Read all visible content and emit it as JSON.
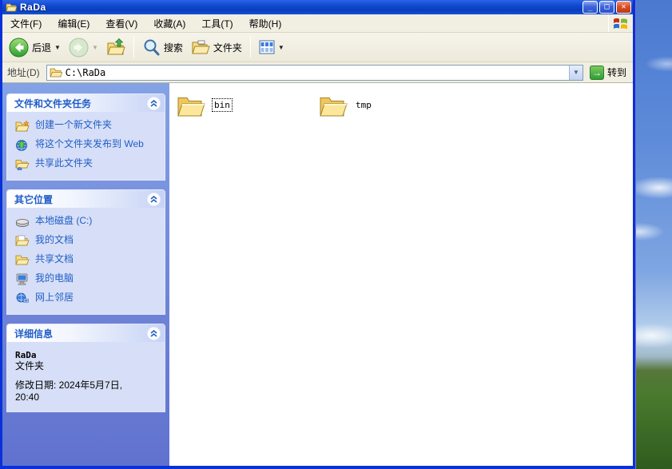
{
  "window": {
    "title": "RaDa"
  },
  "title_bar": {
    "minimize_glyph": "_",
    "maximize_glyph": "□",
    "close_glyph": "✕"
  },
  "menu_bar": {
    "items": [
      "文件(F)",
      "编辑(E)",
      "查看(V)",
      "收藏(A)",
      "工具(T)",
      "帮助(H)"
    ]
  },
  "toolbar": {
    "back_label": "后退",
    "search_label": "搜索",
    "folders_label": "文件夹"
  },
  "address_bar": {
    "label": "地址(D)",
    "value": "C:\\RaDa",
    "go_label": "转到"
  },
  "sidebar": {
    "panels": [
      {
        "title": "文件和文件夹任务",
        "items": [
          {
            "label": "创建一个新文件夹",
            "icon": "new-folder-icon"
          },
          {
            "label": "将这个文件夹发布到 Web",
            "icon": "publish-web-icon"
          },
          {
            "label": "共享此文件夹",
            "icon": "share-folder-icon"
          }
        ]
      },
      {
        "title": "其它位置",
        "items": [
          {
            "label": "本地磁盘 (C:)",
            "icon": "local-disk-icon"
          },
          {
            "label": "我的文档",
            "icon": "my-documents-icon"
          },
          {
            "label": "共享文档",
            "icon": "shared-documents-icon"
          },
          {
            "label": "我的电脑",
            "icon": "my-computer-icon"
          },
          {
            "label": "网上邻居",
            "icon": "network-places-icon"
          }
        ]
      },
      {
        "title": "详细信息",
        "details": {
          "name": "RaDa",
          "type": "文件夹",
          "modified_line1": "修改日期: 2024年5月7日,",
          "modified_line2": "20:40"
        }
      }
    ]
  },
  "content": {
    "folders": [
      {
        "name": "bin",
        "selected": true
      },
      {
        "name": "tmp",
        "selected": false
      }
    ]
  },
  "colors": {
    "titlebar_blue": "#1149CE",
    "window_border": "#0831D9",
    "sidebar_top": "#84A2E6",
    "sidebar_bottom": "#6072CE",
    "panel_body": "#D6DFF7",
    "link_blue": "#215DC6",
    "chrome_tan": "#F1EFE2",
    "close_red": "#DA4F26",
    "go_green": "#2E9E33",
    "folder_yellow": "#F7DC82"
  }
}
